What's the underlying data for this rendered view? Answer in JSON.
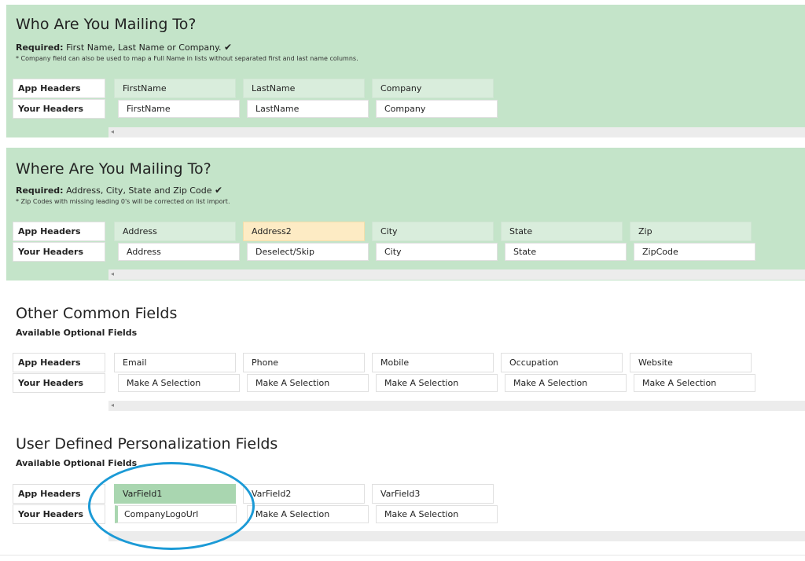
{
  "section1": {
    "title": "Who Are You Mailing To?",
    "required_label": "Required:",
    "required_text": "First Name, Last Name or Company.",
    "check": "✔",
    "note": "* Company field can also be used to map a Full Name in lists without separated first and last name columns.",
    "row_app": "App Headers",
    "row_your": "Your Headers",
    "columns": [
      {
        "app": "FirstName",
        "your": "FirstName"
      },
      {
        "app": "LastName",
        "your": "LastName"
      },
      {
        "app": "Company",
        "your": "Company"
      }
    ]
  },
  "section2": {
    "title": "Where Are You Mailing To?",
    "required_label": "Required:",
    "required_text": "Address, City, State and Zip Code",
    "check": "✔",
    "note": "* Zip Codes with missing leading 0's will be corrected on list import.",
    "row_app": "App Headers",
    "row_your": "Your Headers",
    "columns": [
      {
        "app": "Address",
        "your": "Address"
      },
      {
        "app": "Address2",
        "your": "Deselect/Skip"
      },
      {
        "app": "City",
        "your": "City"
      },
      {
        "app": "State",
        "your": "State"
      },
      {
        "app": "Zip",
        "your": "ZipCode"
      }
    ]
  },
  "section3": {
    "title": "Other Common Fields",
    "subtitle": "Available Optional Fields",
    "row_app": "App Headers",
    "row_your": "Your Headers",
    "columns": [
      {
        "app": "Email",
        "your": "Make A Selection"
      },
      {
        "app": "Phone",
        "your": "Make A Selection"
      },
      {
        "app": "Mobile",
        "your": "Make A Selection"
      },
      {
        "app": "Occupation",
        "your": "Make A Selection"
      },
      {
        "app": "Website",
        "your": "Make A Selection"
      }
    ]
  },
  "section4": {
    "title": "User Defined Personalization Fields",
    "subtitle": "Available Optional Fields",
    "row_app": "App Headers",
    "row_your": "Your Headers",
    "columns": [
      {
        "app": "VarField1",
        "your": "CompanyLogoUrl"
      },
      {
        "app": "VarField2",
        "your": "Make A Selection"
      },
      {
        "app": "VarField3",
        "your": "Make A Selection"
      }
    ]
  },
  "scroll_arrow": "◂",
  "colors": {
    "section_green": "#c4e4c9",
    "header_light_green": "#d9eddc",
    "skipped_yellow": "#fdebc4",
    "selected_green": "#a9d6b0",
    "annotation_blue": "#1b9ad6"
  }
}
